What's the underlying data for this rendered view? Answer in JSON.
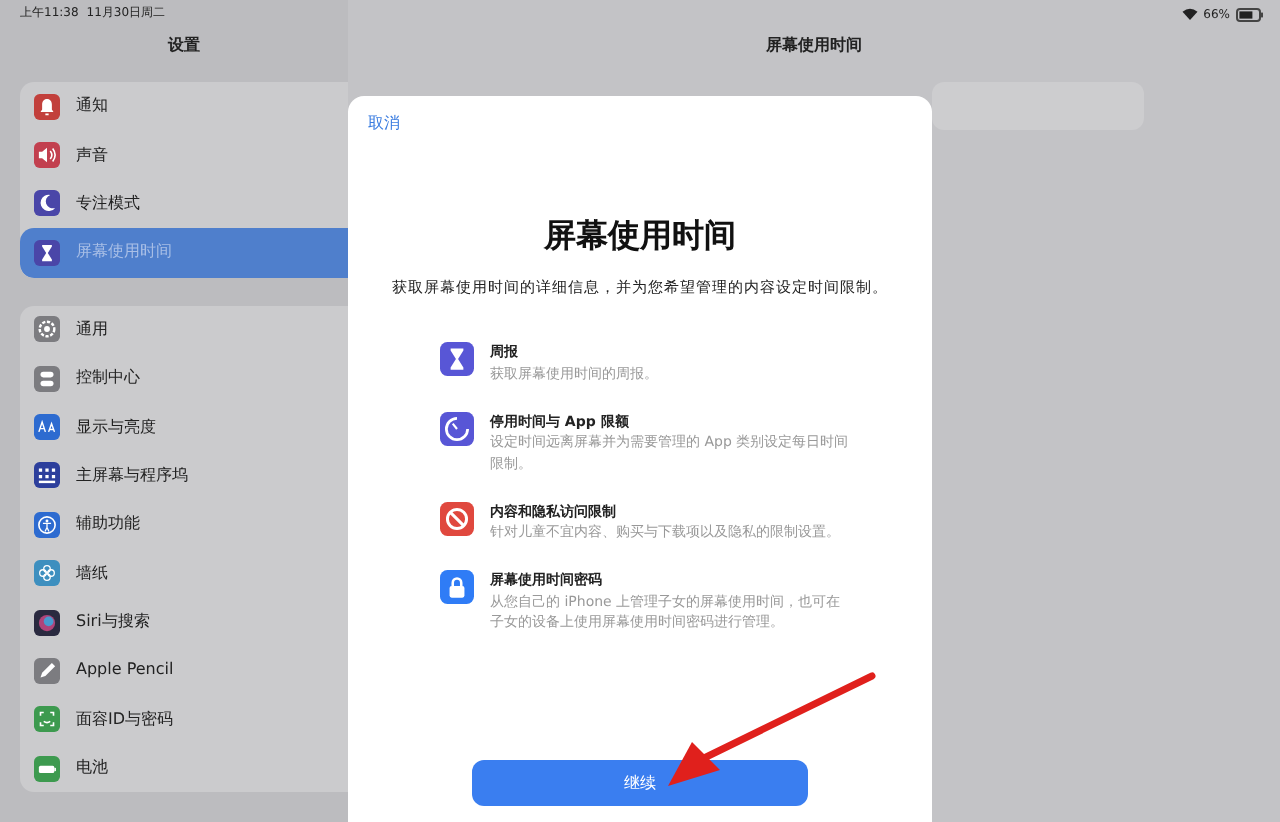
{
  "status_bar": {
    "time": "上午11:38",
    "date": "11月30日周二",
    "battery": "66%"
  },
  "sidebar": {
    "title": "设置",
    "groups": [
      [
        {
          "label": "通知",
          "kind": "bell",
          "color": "#c2403c",
          "selected": false
        },
        {
          "label": "声音",
          "kind": "speaker",
          "color": "#c2404f",
          "selected": false
        },
        {
          "label": "专注模式",
          "kind": "moon",
          "color": "#4a46a8",
          "selected": false
        },
        {
          "label": "屏幕使用时间",
          "kind": "hourglass",
          "color": "#4a46a8",
          "selected": true
        }
      ],
      [
        {
          "label": "通用",
          "kind": "gear",
          "color": "#7c7c80",
          "selected": false
        },
        {
          "label": "控制中心",
          "kind": "switches",
          "color": "#7c7c80",
          "selected": false
        },
        {
          "label": "显示与亮度",
          "kind": "letters",
          "color": "#2d6bd0",
          "selected": false
        },
        {
          "label": "主屏幕与程序坞",
          "kind": "grid",
          "color": "#2d3f9c",
          "selected": false
        },
        {
          "label": "辅助功能",
          "kind": "person",
          "color": "#2d6bd0",
          "selected": false
        },
        {
          "label": "墙纸",
          "kind": "flower",
          "color": "#3d8fbf",
          "selected": false
        },
        {
          "label": "Siri与搜索",
          "kind": "orb",
          "color": "#2a2a40",
          "selected": false
        },
        {
          "label": "Apple Pencil",
          "kind": "pencil",
          "color": "#7c7c80",
          "selected": false
        },
        {
          "label": "面容ID与密码",
          "kind": "face",
          "color": "#3d9a4f",
          "selected": false
        },
        {
          "label": "电池",
          "kind": "battery",
          "color": "#3d9a4f",
          "selected": false
        }
      ]
    ]
  },
  "detail": {
    "title": "屏幕使用时间"
  },
  "sheet": {
    "cancel": "取消",
    "title": "屏幕使用时间",
    "subtitle": "获取屏幕使用时间的详细信息，并为您希望管理的内容设定时间限制。",
    "features": [
      {
        "title": "周报",
        "text": "获取屏幕使用时间的周报。",
        "kind": "hourglass",
        "color": "#5856d6"
      },
      {
        "title": "停用时间与 App 限额",
        "text": "设定时间远离屏幕并为需要管理的 App 类别设定每日时间限制。",
        "kind": "timer",
        "color": "#5856d6"
      },
      {
        "title": "内容和隐私访问限制",
        "text": "针对儿童不宜内容、购买与下载项以及隐私的限制设置。",
        "kind": "block",
        "color": "#e0483e"
      },
      {
        "title": "屏幕使用时间密码",
        "text": "从您自己的 iPhone 上管理子女的屏幕使用时间，也可在子女的设备上使用屏幕使用时间密码进行管理。",
        "kind": "lock",
        "color": "#2f7cf6"
      }
    ],
    "button": "继续"
  }
}
